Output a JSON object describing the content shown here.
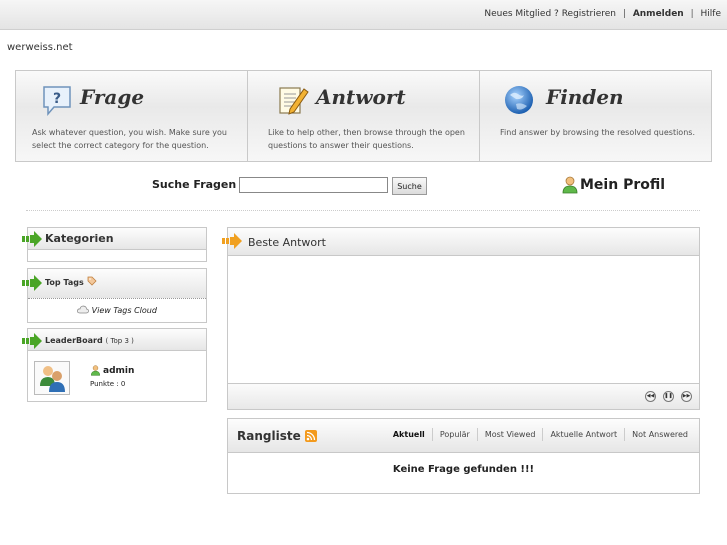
{
  "topnav": {
    "new_member": "Neues Mitglied ?",
    "register": "Registrieren",
    "sep1": "|",
    "login": "Anmelden",
    "sep2": "|",
    "help": "Hilfe"
  },
  "site": {
    "name": "werweiss.net"
  },
  "hero": [
    {
      "title": "Frage",
      "icon": "question-bubble-icon",
      "desc": "Ask whatever question, you wish. Make sure you select the correct category for the question."
    },
    {
      "title": "Antwort",
      "icon": "notepad-pencil-icon",
      "desc": "Like to help other, then browse through the open questions to answer their questions."
    },
    {
      "title": "Finden",
      "icon": "globe-icon",
      "desc": "Find answer by browsing the resolved questions."
    }
  ],
  "search": {
    "label": "Suche Fragen :",
    "value": "",
    "button": "Suche"
  },
  "profile": {
    "label": "Mein Profil",
    "icon": "user-icon"
  },
  "sidebar": {
    "categories": {
      "title": "Kategorien"
    },
    "tags": {
      "title": "Top Tags",
      "cloud_link": "View Tags Cloud"
    },
    "leaderboard": {
      "title": "LeaderBoard",
      "subtitle": "( Top 3 )",
      "entries": [
        {
          "name": "admin",
          "points": "Punkte : 0"
        }
      ]
    }
  },
  "best_answer": {
    "title": "Beste Antwort",
    "controls": [
      "prev",
      "pause",
      "next"
    ]
  },
  "ranking": {
    "title": "Rangliste",
    "tabs": [
      "Aktuell",
      "Populär",
      "Most Viewed",
      "Aktuelle Antwort",
      "Not Answered"
    ],
    "empty": "Keine Frage gefunden !!!"
  },
  "colors": {
    "arrow_green": "#4aa526",
    "arrow_orange": "#f0a020",
    "rss_orange": "#f39a1d"
  }
}
